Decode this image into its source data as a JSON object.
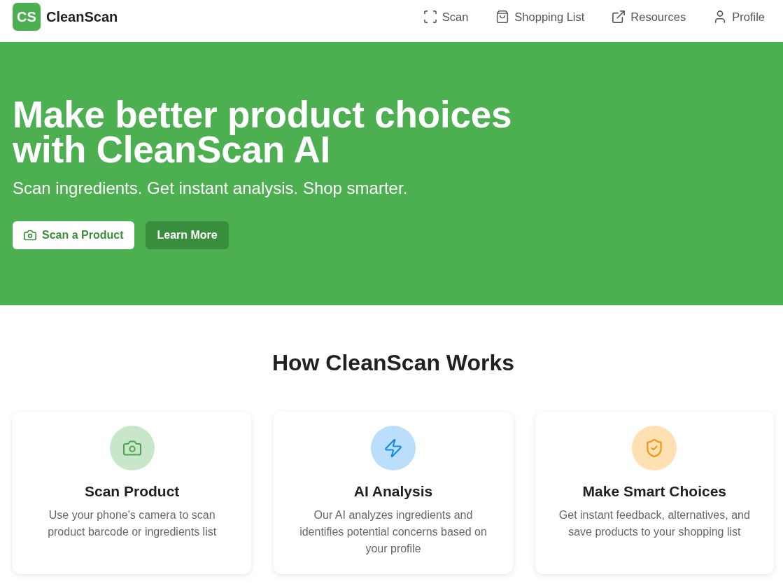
{
  "header": {
    "logo": {
      "mark": "CS",
      "name": "CleanScan"
    },
    "nav": [
      {
        "label": "Scan"
      },
      {
        "label": "Shopping List"
      },
      {
        "label": "Resources"
      },
      {
        "label": "Profile"
      }
    ]
  },
  "hero": {
    "title": "Make better product choices with CleanScan AI",
    "subtitle": "Scan ingredients. Get instant analysis. Shop smarter.",
    "buttons": [
      {
        "label": "Scan a Product",
        "kind": "primary"
      },
      {
        "label": "Learn More",
        "kind": "secondary"
      }
    ]
  },
  "how_it_works": {
    "title": "How CleanScan Works",
    "features": [
      {
        "title": "Scan Product",
        "description": "Use your phone's camera to scan product barcode or ingredients list",
        "color": "#c8e6c9"
      },
      {
        "title": "AI Analysis",
        "description": "Our AI analyzes ingredients and identifies potential concerns based on your profile",
        "color": "#bbdefb"
      },
      {
        "title": "Make Smart Choices",
        "description": "Get instant feedback, alternatives, and save products to your shopping list",
        "color": "#ffe0b2"
      }
    ]
  }
}
